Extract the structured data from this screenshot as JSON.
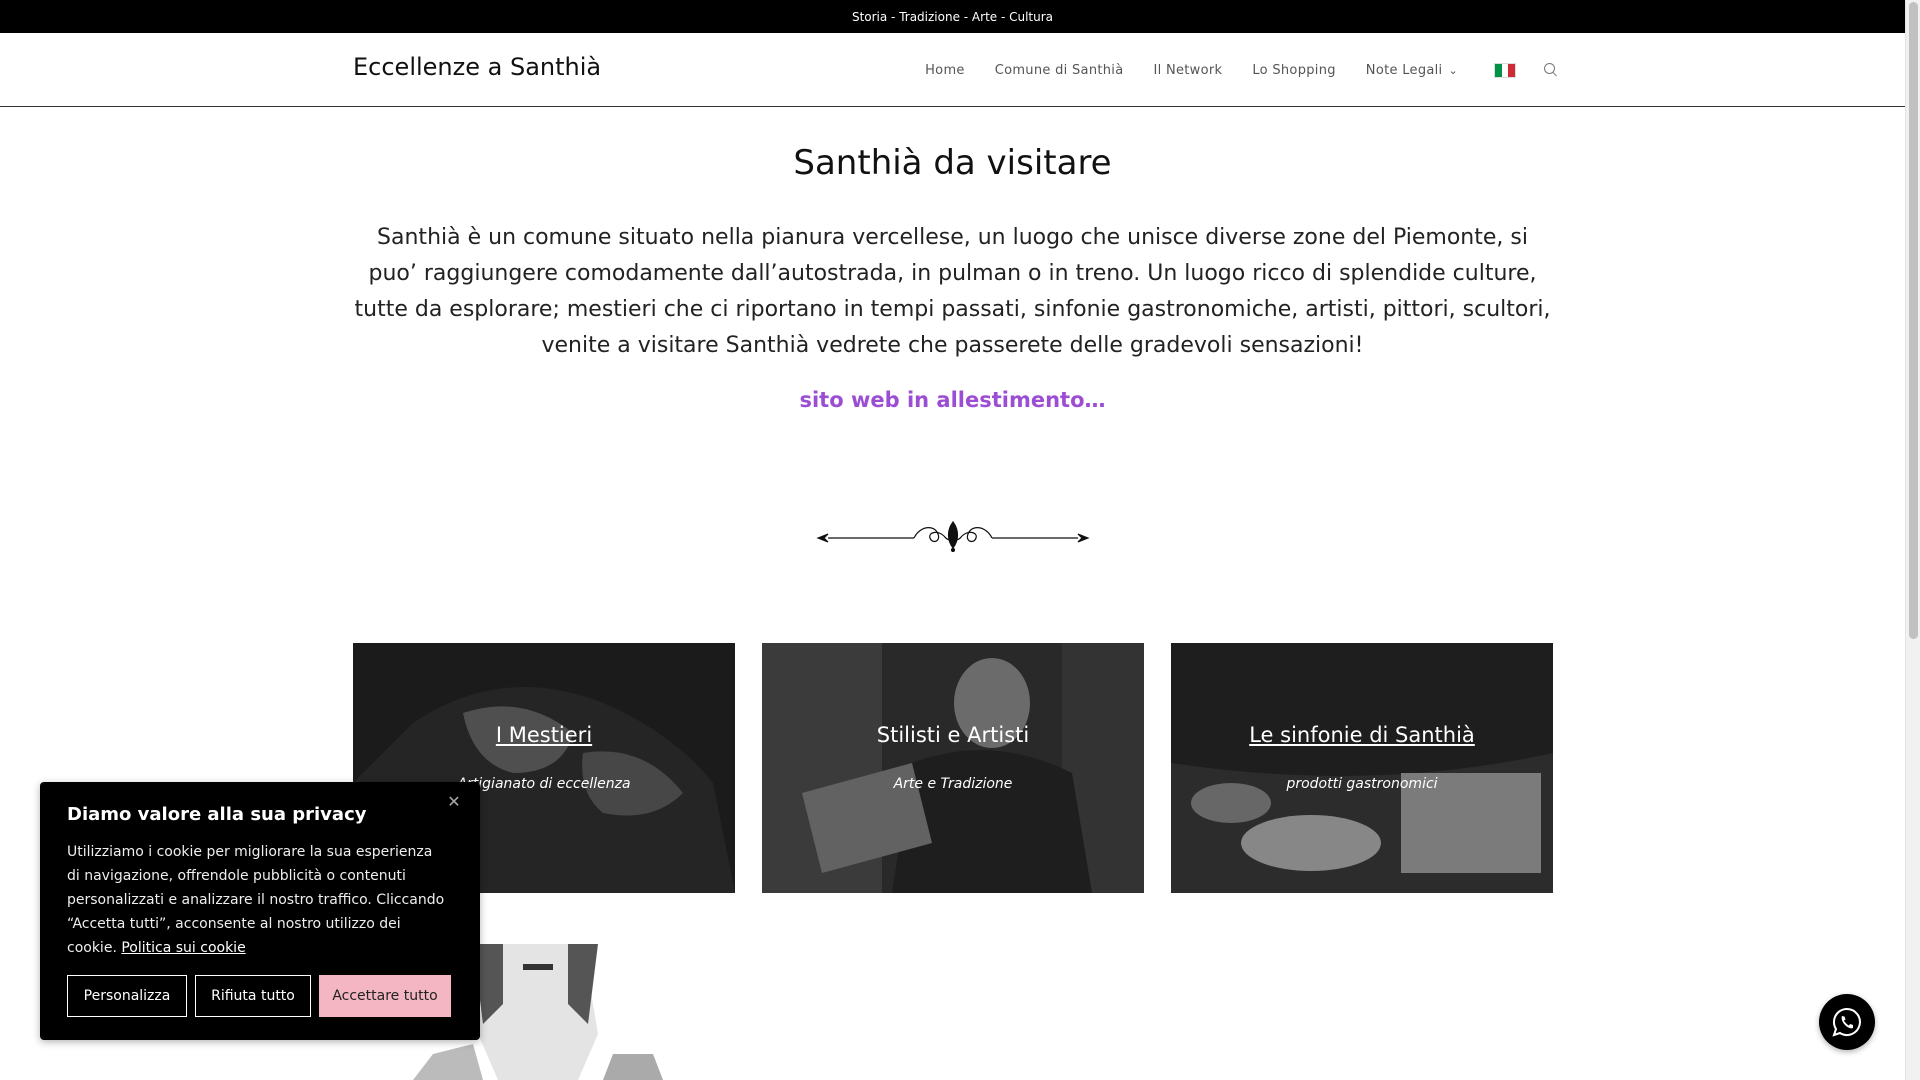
{
  "topbar": {
    "text": "Storia - Tradizione - Arte - Cultura"
  },
  "header": {
    "logo": "Eccellenze a Santhià",
    "nav": [
      {
        "label": "Home"
      },
      {
        "label": "Comune di Santhià"
      },
      {
        "label": "Il Network"
      },
      {
        "label": "Lo Shopping"
      },
      {
        "label": "Note Legali"
      }
    ],
    "flag_icon": "italian-flag-icon",
    "search_icon": "search-icon"
  },
  "main": {
    "title": "Santhià da visitare",
    "intro": "Santhià è un comune situato nella pianura vercellese, un luogo che unisce diverse zone del Piemonte, si puo’ raggiungere comodamente dall’autostrada, in pulman o in treno. Un luogo ricco di splendide culture, tutte da esplorare; mestieri che ci riportano in tempi passati, sinfonie gastronomiche, artisti, pittori, scultori, venite a visitare Santhià vedrete che passerete delle gradevoli sensazioni!",
    "wip": "sito web in allestimento…",
    "wip_color": "#9b4ed3"
  },
  "cards": [
    {
      "title": "I Mestieri",
      "subtitle": "Artigianato di eccellenza"
    },
    {
      "title": "Stilisti e Artisti",
      "subtitle": "Arte e Tradizione"
    },
    {
      "title": "Le sinfonie di Santhià",
      "subtitle": "prodotti gastronomici"
    }
  ],
  "cookie": {
    "title": "Diamo valore alla sua privacy",
    "text": "Utilizziamo i cookie per migliorare la sua esperienza di navigazione, offrendole pubblicità o contenuti personalizzati e analizzare il nostro traffico. Cliccando “Accetta tutti”, acconsente al nostro utilizzo dei cookie.",
    "link": "Politica sui cookie",
    "buttons": {
      "customize": "Personalizza",
      "reject": "Rifiuta tutto",
      "accept": "Accettare tutto"
    },
    "accept_color": "#f4b6c2"
  },
  "whatsapp_icon": "whatsapp-icon"
}
